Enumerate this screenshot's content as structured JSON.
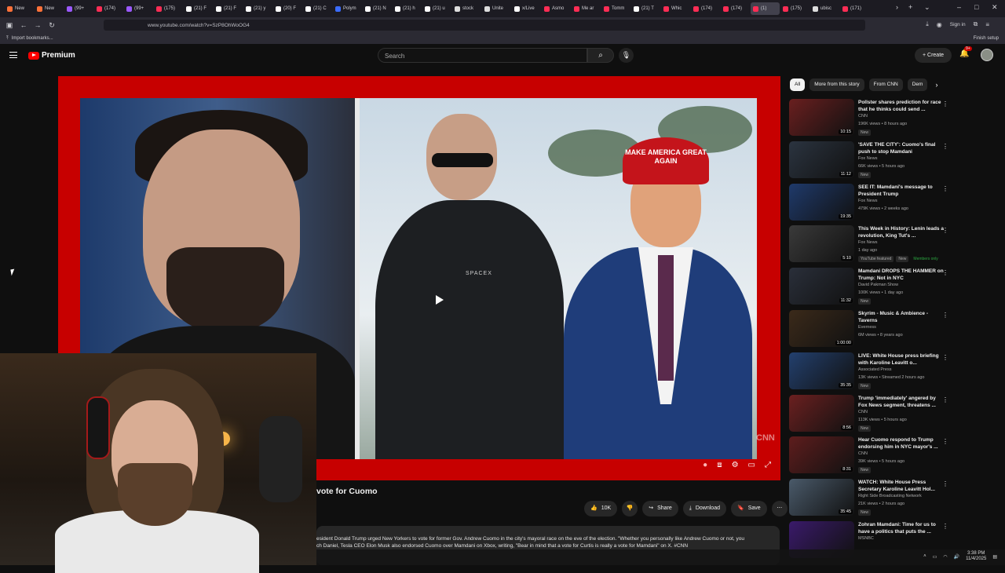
{
  "browser": {
    "tabs": [
      {
        "label": "New",
        "color": "#ff7139"
      },
      {
        "label": "New",
        "color": "#ff7139"
      },
      {
        "label": "(99+",
        "color": "#9b59ff"
      },
      {
        "label": "(174)",
        "color": "#ff2d55"
      },
      {
        "label": "(99+",
        "color": "#9b59ff"
      },
      {
        "label": "(175)",
        "color": "#ff2d55"
      },
      {
        "label": "(21) F",
        "color": "#ffffff"
      },
      {
        "label": "(21) F",
        "color": "#ffffff"
      },
      {
        "label": "(21) y",
        "color": "#ffffff"
      },
      {
        "label": "(20) F",
        "color": "#ffffff"
      },
      {
        "label": "(21) C",
        "color": "#ffffff"
      },
      {
        "label": "Polym",
        "color": "#3b6cff"
      },
      {
        "label": "(21) N",
        "color": "#ffffff"
      },
      {
        "label": "(21) h",
        "color": "#ffffff"
      },
      {
        "label": "(21) u",
        "color": "#ffffff"
      },
      {
        "label": "stock",
        "color": "#dddddd"
      },
      {
        "label": "Unite",
        "color": "#dddddd"
      },
      {
        "label": "x/Live",
        "color": "#ffffff"
      },
      {
        "label": "Asmo",
        "color": "#ff2d55"
      },
      {
        "label": "Me ar",
        "color": "#ff2d55"
      },
      {
        "label": "Tomm",
        "color": "#ff2d55"
      },
      {
        "label": "(21) T",
        "color": "#ffffff"
      },
      {
        "label": "Whic",
        "color": "#ff2d55"
      },
      {
        "label": "(174)",
        "color": "#ff2d55"
      },
      {
        "label": "(174)",
        "color": "#ff2d55"
      },
      {
        "label": "(1)",
        "color": "#ff2d55",
        "active": true
      },
      {
        "label": "(175)",
        "color": "#ff2d55"
      },
      {
        "label": "ubisc",
        "color": "#dddddd"
      },
      {
        "label": "(171)",
        "color": "#ff2d55"
      }
    ],
    "url": "www.youtube.com/watch?v=SzP8OhWoOG4",
    "bookmark": "Import bookmarks...",
    "finish_setup": "Finish setup",
    "sign_in": "Sign in"
  },
  "yt": {
    "logo": "Premium",
    "search_placeholder": "Search",
    "create": "Create",
    "notif_count": "9+"
  },
  "video": {
    "title": "vote for Cuomo",
    "cap_text": "MAKE AMERICA GREAT AGAIN",
    "shirt_text": "SPACEX",
    "watermark": "CNN",
    "likes": "10K",
    "share": "Share",
    "download": "Download",
    "save": "Save",
    "description": "esident Donald Trump urged New Yorkers to vote for former Gov. Andrew Cuomo in the city's mayoral race on the eve of the election. \"Whether you personally like Andrew Cuomo or not, you",
    "description2": "ch Daniel, Tesla CEO Elon Musk also endorsed Cuomo over Mamdani on Xbox, writing, \"Bear in mind that a vote for Curtis is really a vote for Mamdani\" on X. #CNN"
  },
  "chips": [
    {
      "label": "All",
      "active": true
    },
    {
      "label": "More from this story"
    },
    {
      "label": "From CNN"
    },
    {
      "label": "Dem"
    }
  ],
  "recommendations": [
    {
      "title": "Pollster shares prediction for race that he thinks could send ...",
      "channel": "CNN",
      "meta": "196K views • 8 hours ago",
      "badges": [
        "New"
      ],
      "duration": "10:15",
      "thumb": "#6a1f1f"
    },
    {
      "title": "'SAVE THE CITY': Cuomo's final push to stop Mamdani",
      "channel": "Fox News",
      "meta": "66K views • 5 hours ago",
      "badges": [
        "New"
      ],
      "duration": "11:12",
      "thumb": "#2b3440"
    },
    {
      "title": "SEE IT: Mamdani's message to President Trump",
      "channel": "Fox News",
      "meta": "479K views • 2 weeks ago",
      "badges": [],
      "duration": "19:35",
      "thumb": "#1f3a6b"
    },
    {
      "title": "This Week in History: Lenin leads a revolution, King Tut's ...",
      "channel": "Fox News",
      "meta": "1 day ago",
      "badges": [
        "YouTube featured",
        "New"
      ],
      "members": "Members only",
      "duration": "5:10",
      "thumb": "#3a3a3a"
    },
    {
      "title": "Mamdani DROPS THE HAMMER on Trump: Not in NYC",
      "channel": "David Pakman Show",
      "meta": "100K views • 1 day ago",
      "badges": [
        "New"
      ],
      "duration": "11:32",
      "thumb": "#2a2f3a"
    },
    {
      "title": "Skyrim - Music & Ambience - Taverns",
      "channel": "Everness",
      "meta": "6M views • 8 years ago",
      "badges": [],
      "duration": "1:00:00",
      "thumb": "#3b2a1a"
    },
    {
      "title": "LIVE: White House press briefing with Karoline Leavitt o...",
      "channel": "Associated Press",
      "meta": "13K views • Streamed 2 hours ago",
      "badges": [
        "New"
      ],
      "duration": "35:35",
      "thumb": "#23406e"
    },
    {
      "title": "Trump 'immediately' angered by Fox News segment, threatens ...",
      "channel": "CNN",
      "meta": "113K views • 5 hours ago",
      "badges": [
        "New"
      ],
      "duration": "8:56",
      "thumb": "#6b2020"
    },
    {
      "title": "Hear Cuomo respond to Trump endorsing him in NYC mayor's ...",
      "channel": "CNN",
      "meta": "39K views • 5 hours ago",
      "badges": [
        "New"
      ],
      "duration": "8:31",
      "thumb": "#5e1d1d"
    },
    {
      "title": "WATCH: White House Press Secretary Karoline Leavitt Hol...",
      "channel": "Right Side Broadcasting Network",
      "meta": "21K views • 2 hours ago",
      "badges": [
        "New"
      ],
      "duration": "35:45",
      "thumb": "#4a5a6a"
    },
    {
      "title": "Zohran Mamdani: Time for us to have a politics that puts the ...",
      "channel": "MSNBC",
      "meta": "",
      "badges": [],
      "duration": "",
      "thumb": "#3a1a6a"
    }
  ],
  "tray": {
    "time": "3:38 PM",
    "date": "11/4/2025"
  }
}
